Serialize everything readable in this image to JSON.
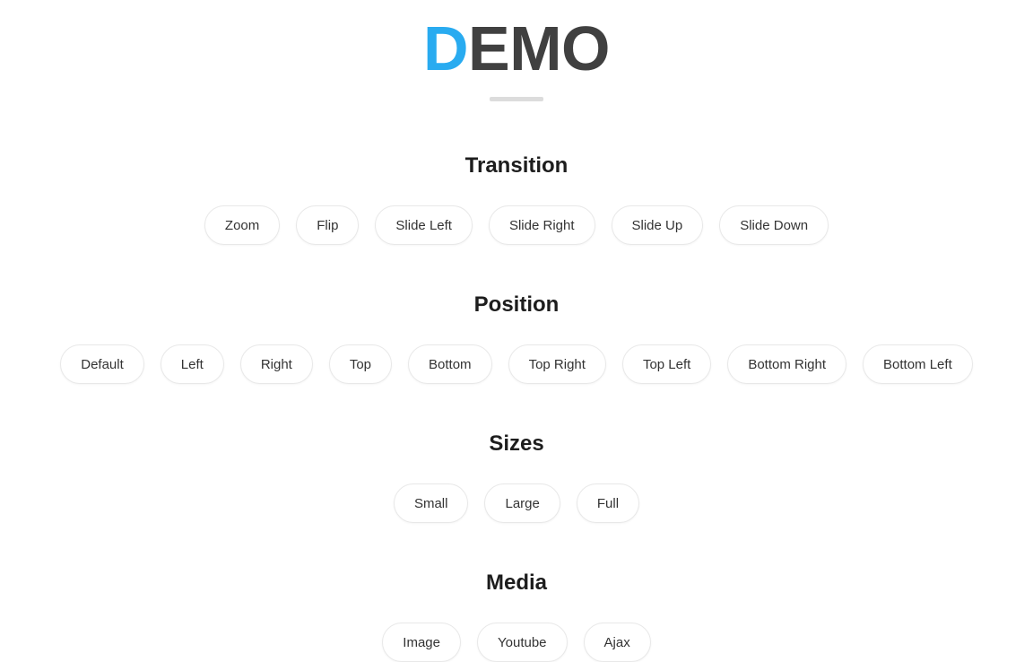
{
  "masthead": {
    "title_initial": "D",
    "title_rest": "EMO",
    "title_full": "DEMO",
    "initial_color": "#29abf0",
    "rest_color": "#404040",
    "divider_color": "#dcdcdc"
  },
  "page": {
    "background_color": "#ffffff",
    "heading_color": "#1d1d1d",
    "button_text_color": "#333333",
    "button_border_color": "#e8e8e8"
  },
  "sections": [
    {
      "id": "transition",
      "title": "Transition",
      "buttons": [
        {
          "label": "Zoom"
        },
        {
          "label": "Flip"
        },
        {
          "label": "Slide Left"
        },
        {
          "label": "Slide Right"
        },
        {
          "label": "Slide Up"
        },
        {
          "label": "Slide Down"
        }
      ]
    },
    {
      "id": "position",
      "title": "Position",
      "buttons": [
        {
          "label": "Default"
        },
        {
          "label": "Left"
        },
        {
          "label": "Right"
        },
        {
          "label": "Top"
        },
        {
          "label": "Bottom"
        },
        {
          "label": "Top Right"
        },
        {
          "label": "Top Left"
        },
        {
          "label": "Bottom Right"
        },
        {
          "label": "Bottom Left"
        }
      ]
    },
    {
      "id": "sizes",
      "title": "Sizes",
      "buttons": [
        {
          "label": "Small"
        },
        {
          "label": "Large"
        },
        {
          "label": "Full"
        }
      ]
    },
    {
      "id": "media",
      "title": "Media",
      "buttons": [
        {
          "label": "Image"
        },
        {
          "label": "Youtube"
        },
        {
          "label": "Ajax"
        }
      ]
    }
  ]
}
